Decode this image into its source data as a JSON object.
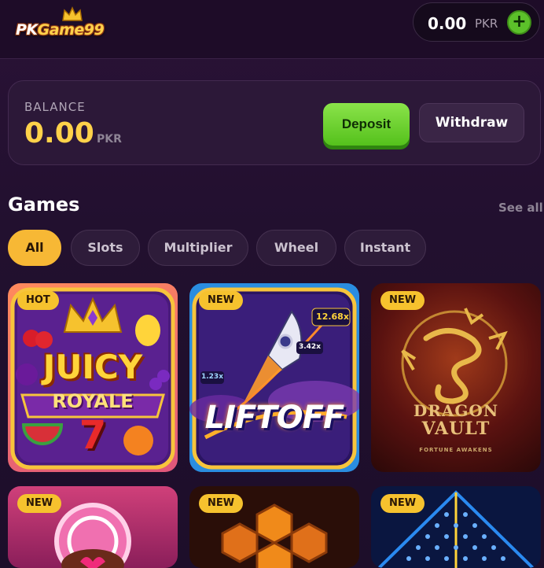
{
  "header": {
    "logo_text_pk": "PK",
    "logo_text_game": "Game99",
    "wallet_amount": "0.00",
    "wallet_currency": "PKR",
    "add_icon": "plus-icon"
  },
  "balance": {
    "label": "BALANCE",
    "amount": "0.00",
    "currency": "PKR",
    "deposit_label": "Deposit",
    "withdraw_label": "Withdraw"
  },
  "games": {
    "title": "Games",
    "see_all": "See all",
    "chips": [
      {
        "label": "All",
        "active": true
      },
      {
        "label": "Slots"
      },
      {
        "label": "Multiplier"
      },
      {
        "label": "Wheel"
      },
      {
        "label": "Instant"
      }
    ],
    "cards": [
      {
        "badge": "HOT",
        "title_line1": "JUICY",
        "title_line2": "ROYALE"
      },
      {
        "badge": "NEW",
        "title_line1": "LIFTOFF",
        "multiplier_top": "12.68x",
        "multiplier_mid": "3.42x",
        "multiplier_low": "1.23x"
      },
      {
        "badge": "NEW",
        "title_line1": "DRAGON",
        "title_line2": "VAULT",
        "tagline": "FORTUNE AWAKENS"
      },
      {
        "badge": "NEW"
      },
      {
        "badge": "NEW"
      },
      {
        "badge": "NEW"
      }
    ]
  },
  "colors": {
    "accent_gold": "#f7b835",
    "deposit_green": "#5cc12a",
    "background": "#22102f"
  }
}
